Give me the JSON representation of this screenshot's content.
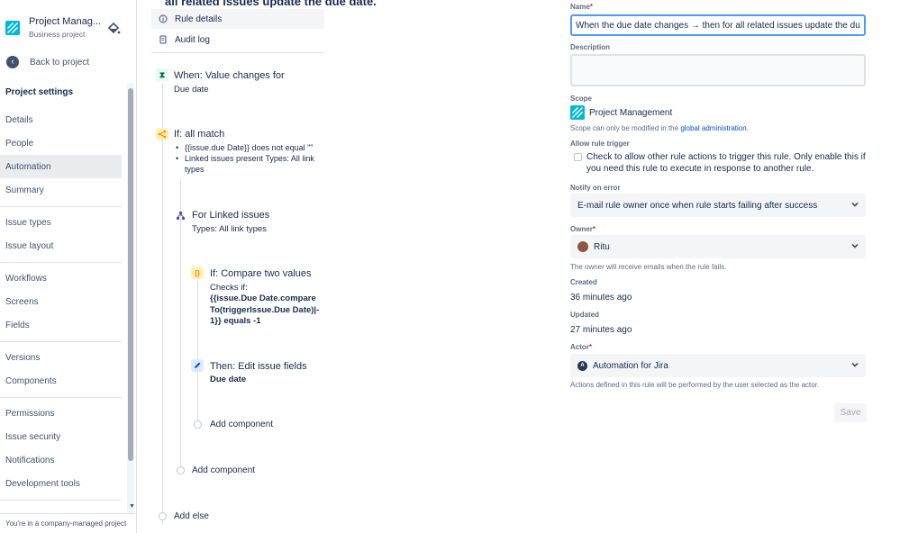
{
  "sidebar": {
    "project_name": "Project Manag...",
    "project_type": "Business project",
    "back_label": "Back to project",
    "section_title": "Project settings",
    "items": [
      {
        "label": "Details"
      },
      {
        "label": "People"
      },
      {
        "label": "Automation"
      },
      {
        "label": "Summary"
      },
      {
        "label": "Issue types"
      },
      {
        "label": "Issue layout"
      },
      {
        "label": "Workflows"
      },
      {
        "label": "Screens"
      },
      {
        "label": "Fields"
      },
      {
        "label": "Versions"
      },
      {
        "label": "Components"
      },
      {
        "label": "Permissions"
      },
      {
        "label": "Issue security"
      },
      {
        "label": "Notifications"
      },
      {
        "label": "Development tools"
      }
    ],
    "active_item": "Automation",
    "footer": "You're in a company-managed project"
  },
  "rule": {
    "cut_title": "all related issues update the due date.",
    "menu": {
      "rule_details": "Rule details",
      "audit_log": "Audit log"
    },
    "trigger": {
      "title": "When: Value changes for",
      "subtitle": "Due date"
    },
    "condition": {
      "title": "If: all match",
      "bullets": [
        "{{issue.due Date}} does not equal \"\"",
        "Linked issues present Types: All link types"
      ]
    },
    "branch": {
      "title": "For Linked issues",
      "subtitle": "Types: All link types"
    },
    "compare": {
      "title": "If: Compare two values",
      "checks_label": "Checks if:",
      "expression": "{{issue.Due Date.compareTo(triggerIssue.Due Date)|-1}} equals -1"
    },
    "action": {
      "title": "Then: Edit issue fields",
      "subtitle": "Due date"
    },
    "add_component_inner": "Add component",
    "add_component_outer": "Add component",
    "add_else": "Add else"
  },
  "form": {
    "name_label": "Name",
    "name_value": "When the due date changes → then for all related issues update the due date.",
    "description_label": "Description",
    "description_value": "",
    "scope_label": "Scope",
    "scope_value": "Project Management",
    "scope_help_prefix": "Scope can only be modified in the ",
    "scope_help_link": "global administration",
    "scope_help_suffix": ".",
    "allow_trigger_label": "Allow rule trigger",
    "allow_trigger_text": "Check to allow other rule actions to trigger this rule. Only enable this if you need this rule to execute in response to another rule.",
    "allow_trigger_checked": false,
    "notify_label": "Notify on error",
    "notify_value": "E-mail rule owner once when rule starts failing after success",
    "owner_label": "Owner",
    "owner_value": "Ritu",
    "owner_help": "The owner will receive emails when the rule fails.",
    "created_label": "Created",
    "created_value": "36 minutes ago",
    "updated_label": "Updated",
    "updated_value": "27 minutes ago",
    "actor_label": "Actor",
    "actor_value": "Automation for Jira",
    "actor_help": "Actions defined in this rule will be performed by the user selected as the actor.",
    "save_label": "Save",
    "required_mark": "*"
  },
  "colors": {
    "accent": "#0052cc",
    "focus_border": "#4c9aff",
    "trigger_icon_bg": "#e3fcef",
    "trigger_icon_fg": "#006644",
    "condition_icon_bg": "#fff0b3",
    "condition_icon_fg": "#ff8b00",
    "branch_icon_fg": "#5243aa",
    "action_icon_bg": "#deebff",
    "action_icon_fg": "#0052cc"
  }
}
